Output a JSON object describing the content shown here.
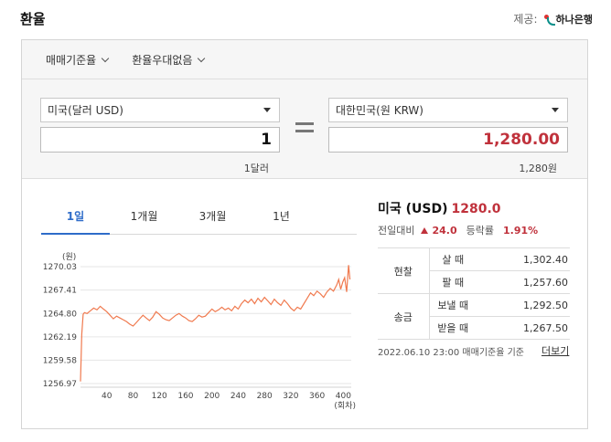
{
  "header": {
    "title": "환율",
    "provider_label": "제공:",
    "provider_name": "하나은행"
  },
  "filters": [
    {
      "label": "매매기준율"
    },
    {
      "label": "환율우대없음"
    }
  ],
  "converter": {
    "from_currency": "미국(달러 USD)",
    "to_currency": "대한민국(원 KRW)",
    "from_amount": "1",
    "to_amount": "1,280.00",
    "from_unit": "1달러",
    "to_unit": "1,280원"
  },
  "tabs": [
    {
      "label": "1일"
    },
    {
      "label": "1개월"
    },
    {
      "label": "3개월"
    },
    {
      "label": "1년"
    }
  ],
  "rate": {
    "name": "미국 (USD)",
    "value": "1280.0",
    "change_label": "전일대비",
    "change": "24.0",
    "pct_label": "등락률",
    "pct": "1.91%",
    "up_color": "#c0323c"
  },
  "rate_table": {
    "cash_label": "현찰",
    "remit_label": "송금",
    "rows": [
      {
        "label": "살 때",
        "value": "1,302.40"
      },
      {
        "label": "팔 때",
        "value": "1,257.60"
      },
      {
        "label": "보낼 때",
        "value": "1,292.50"
      },
      {
        "label": "받을 때",
        "value": "1,267.50"
      }
    ]
  },
  "footer": {
    "note": "2022.06.10 23:00  매매기준율 기준",
    "more": "더보기"
  },
  "chart_data": {
    "type": "line",
    "ylabel": "(원)",
    "xlabel": "(회차)",
    "y_ticks": [
      "1270.03",
      "1267.41",
      "1264.80",
      "1262.19",
      "1259.58",
      "1256.97"
    ],
    "x_ticks": [
      "40",
      "80",
      "120",
      "160",
      "200",
      "240",
      "280",
      "320",
      "360",
      "400"
    ],
    "ylim": [
      1256.97,
      1270.03
    ],
    "xlim": [
      0,
      412
    ],
    "color": "#f07a4f",
    "series": [
      {
        "x": [
          0,
          2,
          4,
          6,
          10,
          15,
          20,
          25,
          30,
          35,
          40,
          45,
          50,
          55,
          60,
          65,
          70,
          75,
          80,
          85,
          90,
          95,
          100,
          105,
          110,
          115,
          120,
          125,
          130,
          135,
          140,
          145,
          150,
          155,
          160,
          165,
          170,
          175,
          180,
          185,
          190,
          195,
          200,
          205,
          210,
          215,
          220,
          225,
          230,
          235,
          240,
          245,
          250,
          255,
          260,
          265,
          270,
          275,
          280,
          285,
          290,
          295,
          300,
          305,
          310,
          315,
          320,
          325,
          330,
          335,
          340,
          345,
          350,
          355,
          360,
          365,
          370,
          375,
          380,
          385,
          390,
          393,
          396,
          399,
          402,
          405,
          408,
          410
        ],
        "y": [
          1257.2,
          1262.5,
          1264.7,
          1264.9,
          1264.8,
          1265.1,
          1265.4,
          1265.2,
          1265.6,
          1265.3,
          1265.0,
          1264.6,
          1264.2,
          1264.5,
          1264.3,
          1264.1,
          1263.9,
          1263.6,
          1263.4,
          1263.8,
          1264.2,
          1264.6,
          1264.3,
          1264.0,
          1264.4,
          1265.0,
          1264.7,
          1264.3,
          1264.1,
          1264.0,
          1264.3,
          1264.6,
          1264.8,
          1264.5,
          1264.3,
          1264.0,
          1263.9,
          1264.2,
          1264.6,
          1264.4,
          1264.5,
          1264.9,
          1265.3,
          1265.0,
          1265.2,
          1265.5,
          1265.2,
          1265.4,
          1265.1,
          1265.6,
          1265.3,
          1265.9,
          1266.3,
          1266.0,
          1266.4,
          1265.9,
          1266.5,
          1266.1,
          1266.6,
          1266.2,
          1265.8,
          1266.4,
          1266.0,
          1265.7,
          1266.3,
          1265.9,
          1265.4,
          1265.1,
          1265.5,
          1265.3,
          1265.9,
          1266.5,
          1267.1,
          1266.8,
          1267.3,
          1267.0,
          1266.6,
          1267.2,
          1267.6,
          1267.3,
          1268.0,
          1268.6,
          1267.5,
          1268.3,
          1268.8,
          1267.2,
          1270.2,
          1268.6
        ]
      }
    ]
  }
}
